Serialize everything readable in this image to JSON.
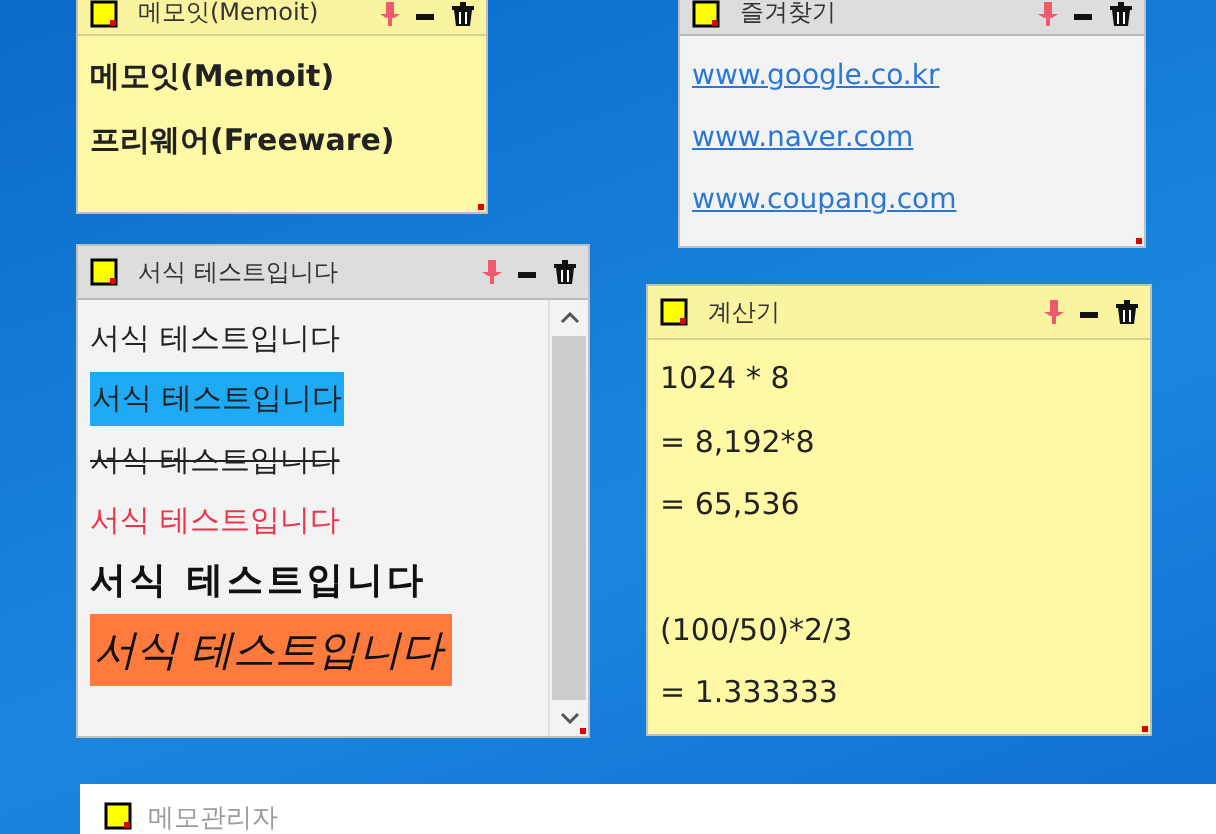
{
  "notes": [
    {
      "title": "메모잇(Memoit)",
      "color": "#fff9a5",
      "lines": [
        {
          "kind": "bold",
          "text": "메모잇(Memoit)"
        },
        {
          "kind": "bold",
          "text": "프리웨어(Freeware)"
        }
      ]
    },
    {
      "title": "즐겨찾기",
      "color": "#f3f3f3",
      "lines": [
        {
          "kind": "link",
          "text": "www.google.co.kr"
        },
        {
          "kind": "link",
          "text": "www.naver.com"
        },
        {
          "kind": "link",
          "text": "www.coupang.com"
        }
      ]
    },
    {
      "title": "서식 테스트입니다",
      "color": "#f3f3f3",
      "scrollbar": true,
      "lines": [
        {
          "kind": "plain",
          "text": "서식 테스트입니다"
        },
        {
          "kind": "highlight",
          "text": "서식 테스트입니다"
        },
        {
          "kind": "strike",
          "text": "서식 테스트입니다"
        },
        {
          "kind": "red",
          "text": "서식 테스트입니다"
        },
        {
          "kind": "brush",
          "text": "서식 테스트입니다"
        },
        {
          "kind": "big-italic",
          "text": "서식 테스트입니다"
        }
      ]
    },
    {
      "title": "계산기",
      "color": "#fff9a5",
      "lines": [
        {
          "kind": "plain",
          "text": "1024 * 8"
        },
        {
          "kind": "plain",
          "text": "= 8,192*8"
        },
        {
          "kind": "plain",
          "text": "= 65,536"
        },
        {
          "kind": "plain",
          "text": "(100/50)*2/3",
          "spaced": true
        },
        {
          "kind": "plain",
          "text": "= 1.333333"
        }
      ]
    }
  ],
  "manager": {
    "title": "메모관리자"
  }
}
